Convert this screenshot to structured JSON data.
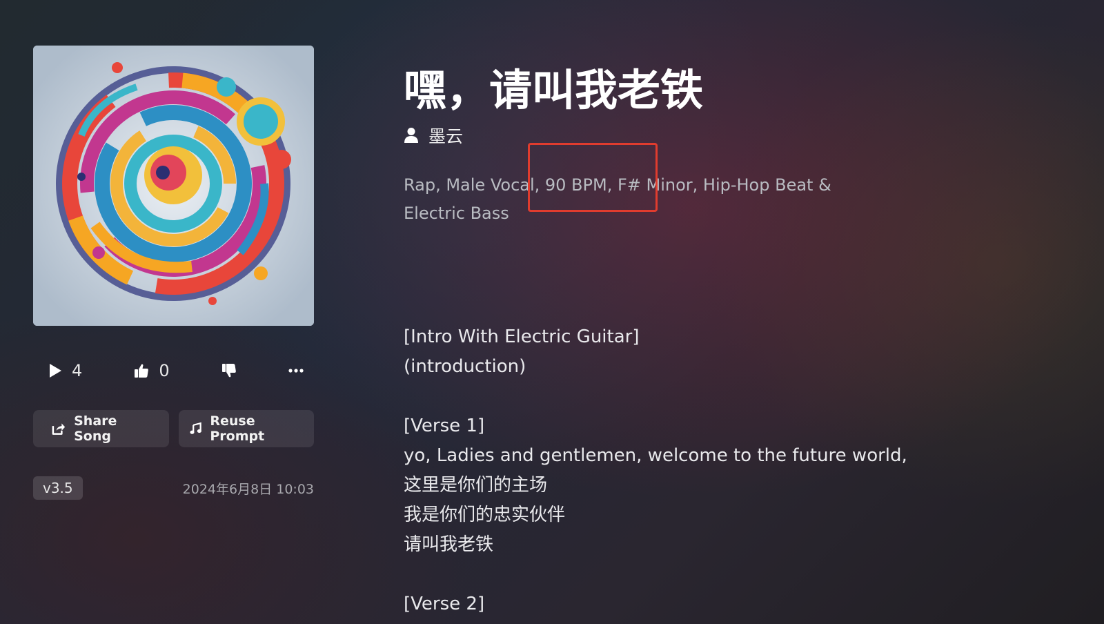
{
  "song": {
    "title": "嘿，请叫我老铁",
    "artist": "墨云",
    "tags": "Rap, Male Vocal, 90 BPM, F# Minor, Hip-Hop Beat & Electric Bass",
    "highlight_color": "#e03c2e"
  },
  "stats": {
    "plays": "4",
    "likes": "0"
  },
  "actions": {
    "share_label": "Share Song",
    "reuse_label": "Reuse Prompt"
  },
  "meta": {
    "version": "v3.5",
    "date": "2024年6月8日 10:03"
  },
  "icons": [
    "play-icon",
    "thumbs-up-icon",
    "thumbs-down-icon",
    "more-icon",
    "share-icon",
    "music-note-icon",
    "user-icon"
  ],
  "lyrics": [
    "[Intro With Electric Guitar]",
    "(introduction)",
    "",
    "[Verse 1]",
    "yo, Ladies and gentlemen, welcome to the future world,",
    "这里是你们的主场",
    "我是你们的忠实伙伴",
    "请叫我老铁",
    "",
    "[Verse 2]"
  ]
}
